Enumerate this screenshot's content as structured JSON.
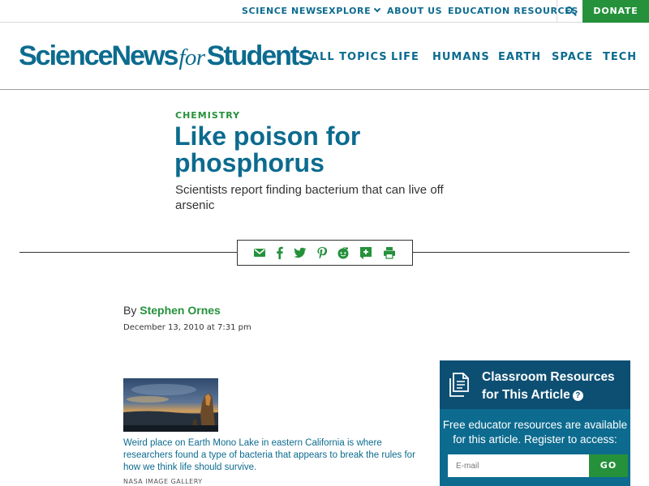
{
  "topbar": {
    "science_news": "SCIENCE NEWS",
    "explore": "EXPLORE",
    "about": "ABOUT US",
    "education": "EDUCATION RESOURCES",
    "donate": "DONATE"
  },
  "header": {
    "logo_science_news": "ScienceNews",
    "logo_for": "for",
    "logo_students": "Students",
    "nav": [
      "ALL TOPICS",
      "LIFE",
      "HUMANS",
      "EARTH",
      "SPACE",
      "TECH"
    ]
  },
  "article": {
    "category": "CHEMISTRY",
    "headline": "Like poison for phosphorus",
    "dek": "Scientists report finding bacterium that can live off arsenic",
    "byline_prefix": "By",
    "author": "Stephen Ornes",
    "date": "December 13, 2010 at 7:31 pm",
    "caption": "Weird place on Earth Mono Lake in eastern California is where researchers found a type of bacteria that appears to break the rules for how we think life should survive.",
    "credit": "NASA IMAGE GALLERY"
  },
  "share_icons": [
    "email-icon",
    "facebook-icon",
    "twitter-icon",
    "pinterest-icon",
    "reddit-icon",
    "google-classroom-icon",
    "print-icon"
  ],
  "sidebar": {
    "title": "Classroom Resources for This Article",
    "text": "Free educator resources are available for this article. Register to access:",
    "email_placeholder": "E-mail",
    "go": "GO"
  },
  "colors": {
    "brand_blue": "#0c6b8f",
    "brand_green": "#25913b",
    "sidebar_dark": "#0d4f73"
  }
}
